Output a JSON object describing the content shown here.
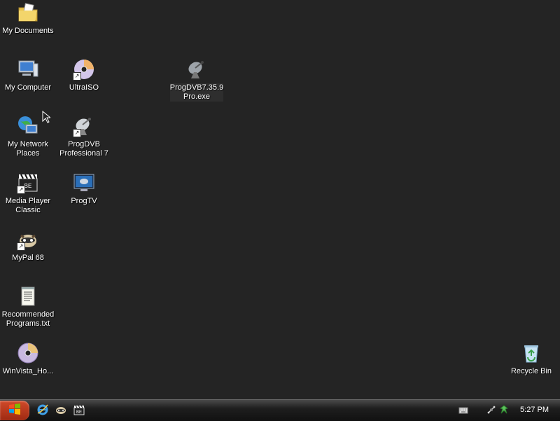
{
  "desktop": {
    "icons": [
      {
        "label": "My Documents",
        "icon": "folder-documents-icon"
      },
      {
        "label": "My Computer",
        "icon": "computer-icon"
      },
      {
        "label": "My Network\nPlaces",
        "icon": "network-places-icon"
      },
      {
        "label": "Media Player\nClassic",
        "icon": "media-player-classic-icon"
      },
      {
        "label": "MyPal 68",
        "icon": "mypal-icon"
      },
      {
        "label": "Recommended\nPrograms.txt",
        "icon": "text-file-icon"
      },
      {
        "label": "WinVista_Ho...",
        "icon": "disc-image-icon"
      },
      {
        "label": "UltraISO",
        "icon": "ultraiso-icon"
      },
      {
        "label": "ProgDVB\nProfessional 7",
        "icon": "progdvb-icon"
      },
      {
        "label": "ProgTV",
        "icon": "progtv-icon"
      },
      {
        "label": "ProgDVB7.35.9\nPro.exe",
        "icon": "satellite-dish-icon"
      },
      {
        "label": "Recycle Bin",
        "icon": "recycle-bin-icon"
      }
    ]
  },
  "taskbar": {
    "start_icon": "windows-logo-icon",
    "quick_launch": [
      "internet-explorer-icon",
      "mypal-icon",
      "media-player-classic-icon"
    ],
    "tray": [
      "keyboard-icon",
      "network-icon",
      "safely-remove-icon"
    ],
    "clock": "5:27 PM"
  },
  "colors": {
    "desktop_bg": "#242424",
    "start_button": "#c0391b",
    "label_text": "#ffffff"
  }
}
